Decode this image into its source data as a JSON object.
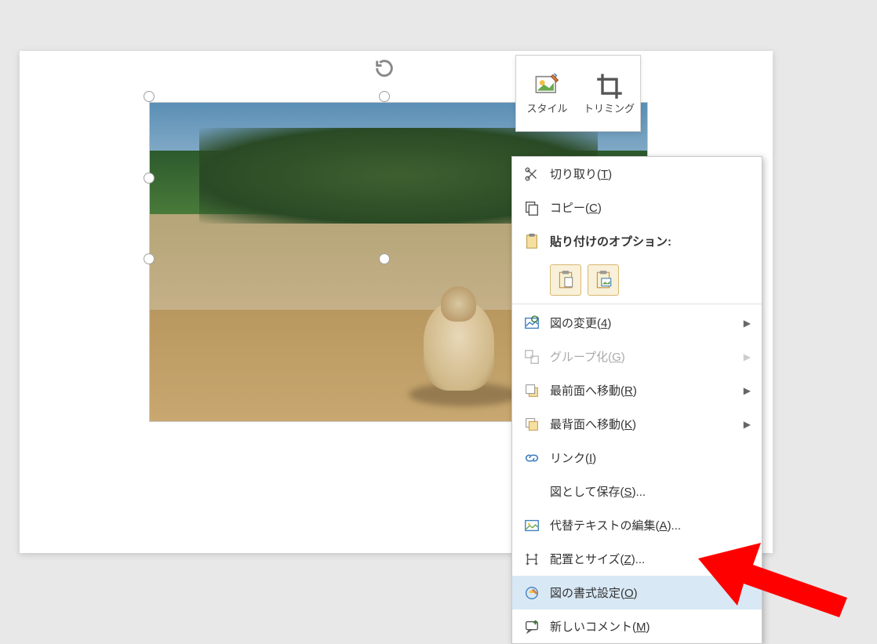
{
  "mini_toolbar": {
    "style_label": "スタイル",
    "crop_label": "トリミング"
  },
  "context_menu": {
    "cut": "切り取り(T)",
    "copy": "コピー(C)",
    "paste_options_header": "貼り付けのオプション:",
    "change_picture": "図の変更(4)",
    "group": "グループ化(G)",
    "bring_front": "最前面へ移動(R)",
    "send_back": "最背面へ移動(K)",
    "link": "リンク(I)",
    "save_as_picture": "図として保存(S)...",
    "alt_text": "代替テキストの編集(A)...",
    "size_position": "配置とサイズ(Z)...",
    "format_picture": "図の書式設定(O)",
    "new_comment": "新しいコメント(M)"
  },
  "hotkeys": {
    "cut": "T",
    "copy": "C",
    "change_picture": "4",
    "group": "G",
    "bring_front": "R",
    "send_back": "K",
    "link": "I",
    "save_as_picture": "S",
    "alt_text": "A",
    "size_position": "Z",
    "format_picture": "O",
    "new_comment": "M"
  }
}
